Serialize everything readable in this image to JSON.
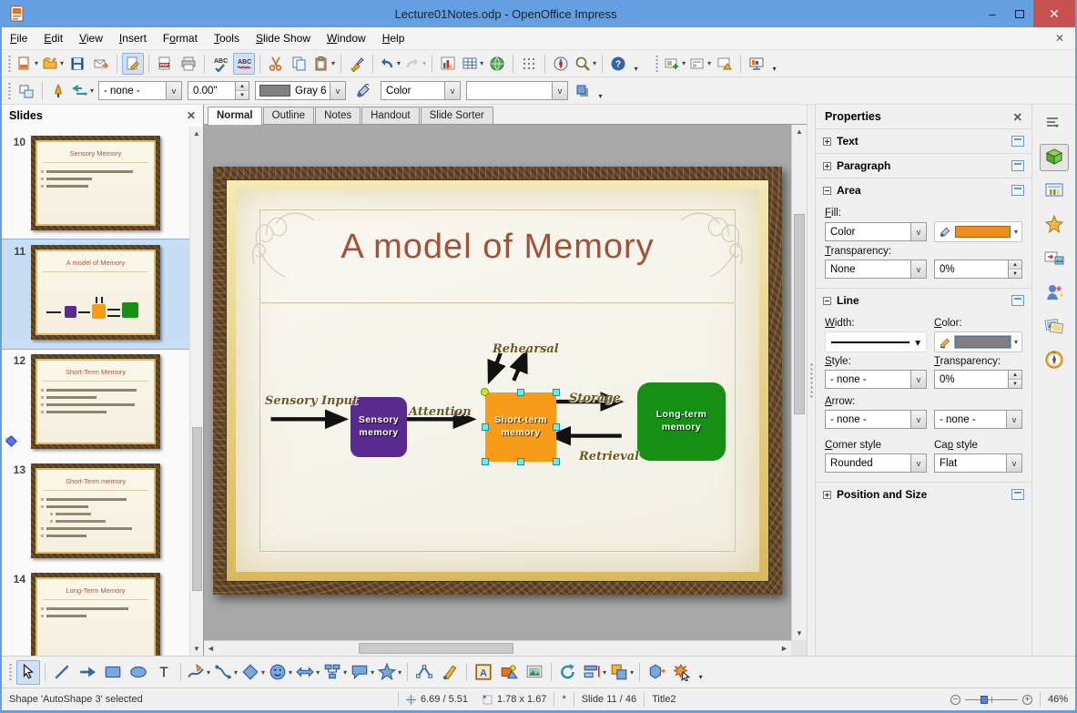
{
  "window": {
    "title": "Lecture01Notes.odp - OpenOffice Impress",
    "minimize": "–",
    "close": "✕"
  },
  "menubar": {
    "items": [
      {
        "label": "File",
        "u": 0
      },
      {
        "label": "Edit",
        "u": 0
      },
      {
        "label": "View",
        "u": 0
      },
      {
        "label": "Insert",
        "u": 0
      },
      {
        "label": "Format",
        "u": 1
      },
      {
        "label": "Tools",
        "u": 0
      },
      {
        "label": "Slide Show",
        "u": 0
      },
      {
        "label": "Window",
        "u": 0
      },
      {
        "label": "Help",
        "u": 0
      }
    ],
    "close_doc": "✕"
  },
  "toolbars": {
    "standard": [
      {
        "grip": true
      },
      {
        "icon": "new-doc",
        "dd": true
      },
      {
        "icon": "open",
        "dd": true
      },
      {
        "icon": "save"
      },
      {
        "icon": "email"
      },
      {
        "sep": true
      },
      {
        "icon": "edit-file",
        "active": true
      },
      {
        "sep": true
      },
      {
        "icon": "export-pdf"
      },
      {
        "icon": "print"
      },
      {
        "sep": true
      },
      {
        "icon": "spellcheck"
      },
      {
        "icon": "auto-spellcheck",
        "active": true
      },
      {
        "sep": true
      },
      {
        "icon": "cut"
      },
      {
        "icon": "copy"
      },
      {
        "icon": "paste",
        "dd": true
      },
      {
        "sep": true
      },
      {
        "icon": "clone-formatting"
      },
      {
        "sep": true
      },
      {
        "icon": "undo",
        "dd": true
      },
      {
        "icon": "redo",
        "dd": true,
        "disabled": true
      },
      {
        "sep": true
      },
      {
        "icon": "chart"
      },
      {
        "icon": "table",
        "dd": true
      },
      {
        "icon": "hyperlink"
      },
      {
        "sep": true
      },
      {
        "icon": "grid"
      },
      {
        "sep": true
      },
      {
        "icon": "navigator"
      },
      {
        "icon": "zoom",
        "dd": true
      },
      {
        "sep": true
      },
      {
        "icon": "help"
      },
      {
        "more": true
      },
      {
        "gap": true
      },
      {
        "grip": true
      },
      {
        "icon": "new-slide",
        "dd": true
      },
      {
        "icon": "slide-layout",
        "dd": true
      },
      {
        "icon": "slide-design"
      },
      {
        "sep": true
      },
      {
        "icon": "slide-show"
      },
      {
        "more": true
      }
    ],
    "line_filling": {
      "line_style": "- none -",
      "line_width": "0.00\"",
      "line_color": "Gray 6",
      "fill_type": "Color",
      "fill_value": ""
    },
    "drawing": [
      {
        "grip": true
      },
      {
        "icon": "select",
        "active": true
      },
      {
        "sep": true
      },
      {
        "icon": "line"
      },
      {
        "icon": "arrow"
      },
      {
        "icon": "rectangle"
      },
      {
        "icon": "ellipse"
      },
      {
        "icon": "text"
      },
      {
        "sep": true
      },
      {
        "icon": "curve",
        "dd": true
      },
      {
        "icon": "connector",
        "dd": true
      },
      {
        "icon": "basic-shapes",
        "dd": true
      },
      {
        "icon": "symbol-shapes",
        "dd": true
      },
      {
        "icon": "block-arrows",
        "dd": true
      },
      {
        "icon": "flowchart",
        "dd": true
      },
      {
        "icon": "callouts",
        "dd": true
      },
      {
        "icon": "stars",
        "dd": true
      },
      {
        "sep": true
      },
      {
        "icon": "edit-points"
      },
      {
        "icon": "glue-points"
      },
      {
        "sep": true
      },
      {
        "icon": "fontwork-gallery"
      },
      {
        "icon": "from-file"
      },
      {
        "icon": "gallery-img"
      },
      {
        "sep": true
      },
      {
        "icon": "rotate"
      },
      {
        "icon": "alignment",
        "dd": true
      },
      {
        "icon": "arrange",
        "dd": true
      },
      {
        "sep": true
      },
      {
        "icon": "extrusion"
      },
      {
        "icon": "interaction"
      },
      {
        "more": true
      }
    ]
  },
  "view_tabs": {
    "items": [
      "Normal",
      "Outline",
      "Notes",
      "Handout",
      "Slide Sorter"
    ],
    "active": "Normal"
  },
  "slides_panel": {
    "title": "Slides",
    "close": "✕",
    "slides": [
      {
        "number": "10",
        "title": "Sensory Memory",
        "kind": "bullets",
        "bullet_lines": [
          0.86,
          0.45,
          0.42
        ],
        "selected": false,
        "animated": false
      },
      {
        "number": "11",
        "title": "A model of Memory",
        "kind": "diagram",
        "selected": true,
        "animated": false
      },
      {
        "number": "12",
        "title": "Short-Term Memory",
        "kind": "bullets",
        "bullet_lines": [
          0.9,
          0.5,
          0.88,
          0.6
        ],
        "selected": false,
        "animated": true
      },
      {
        "number": "13",
        "title": "Short-Term memory",
        "kind": "bullets",
        "bullet_lines": [
          0.8,
          0.42,
          -0.35,
          -0.5,
          0.85,
          0.4
        ],
        "selected": false,
        "animated": false
      },
      {
        "number": "14",
        "title": "Long-Term Memory",
        "kind": "bullets",
        "bullet_lines": [
          0.82,
          0.4
        ],
        "selected": false,
        "animated": false
      }
    ]
  },
  "slide": {
    "title": "A model of Memory",
    "boxes": [
      {
        "id": "sensory",
        "label": "Sensory\nmemory",
        "color": "#5a2b8e"
      },
      {
        "id": "short-term",
        "label": "Short-term\nmemory",
        "color": "#f79b18",
        "selected": true
      },
      {
        "id": "long-term",
        "label": "Long-term\nmemory",
        "color": "#159015"
      }
    ],
    "labels": {
      "sensory_input": "Sensory Input",
      "attention": "Attention",
      "rehearsal": "Rehearsal",
      "storage": "Storage",
      "retrieval": "Retrieval"
    }
  },
  "properties": {
    "title": "Properties",
    "close": "✕",
    "sections": {
      "text": {
        "label": "Text",
        "expanded": false
      },
      "paragraph": {
        "label": "Paragraph",
        "expanded": false
      },
      "area": {
        "label": "Area",
        "expanded": true
      },
      "line": {
        "label": "Line",
        "expanded": true
      },
      "possize": {
        "label": "Position and Size",
        "expanded": false
      }
    },
    "area": {
      "fill_label": {
        "text": "Fill:",
        "u": 0
      },
      "fill_type": "Color",
      "fill_color": "#f08c1e",
      "transparency_label": {
        "text": "Transparency:",
        "u": 0
      },
      "transparency_type": "None",
      "transparency_value": "0%"
    },
    "line": {
      "width_label": {
        "text": "Width:",
        "u": 0
      },
      "color_label": {
        "text": "Color:",
        "u": 0
      },
      "line_color": "#808080",
      "style_label": {
        "text": "Style:",
        "u": 0
      },
      "style_value": "- none -",
      "transparency_label": {
        "text": "Transparency:",
        "u": 0
      },
      "transparency_value": "0%",
      "arrow_label": {
        "text": "Arrow:",
        "u": 0
      },
      "arrow_start": "- none -",
      "arrow_end": "- none -",
      "corner_label": {
        "text": "Corner style",
        "u": 0
      },
      "corner_value": "Rounded",
      "cap_label": {
        "text": "Cap style",
        "u": 2
      },
      "cap_value": "Flat"
    }
  },
  "sidebar_tabs": [
    {
      "name": "sidebar-settings"
    },
    {
      "name": "properties",
      "active": true
    },
    {
      "name": "master-pages"
    },
    {
      "name": "custom-animation"
    },
    {
      "name": "slide-transition"
    },
    {
      "name": "animation-effects"
    },
    {
      "name": "gallery"
    },
    {
      "name": "navigator"
    }
  ],
  "statusbar": {
    "status": "Shape 'AutoShape 3' selected",
    "position": "6.69 / 5.51",
    "size": "1.78 x 1.67",
    "modified": "*",
    "slide": "Slide 11 / 46",
    "layout": "Title2",
    "zoom": "46%"
  },
  "colors": {
    "titlebar": "#64a0e1",
    "close_button": "#c75050",
    "workspace": "#a9a9a9",
    "selection_handle": "#6fe9e9",
    "adjust_handle": "#cde522",
    "box_purple": "#5a2b8e",
    "box_orange": "#f79b18",
    "box_green": "#159015",
    "slide_title": "#a3523a"
  }
}
